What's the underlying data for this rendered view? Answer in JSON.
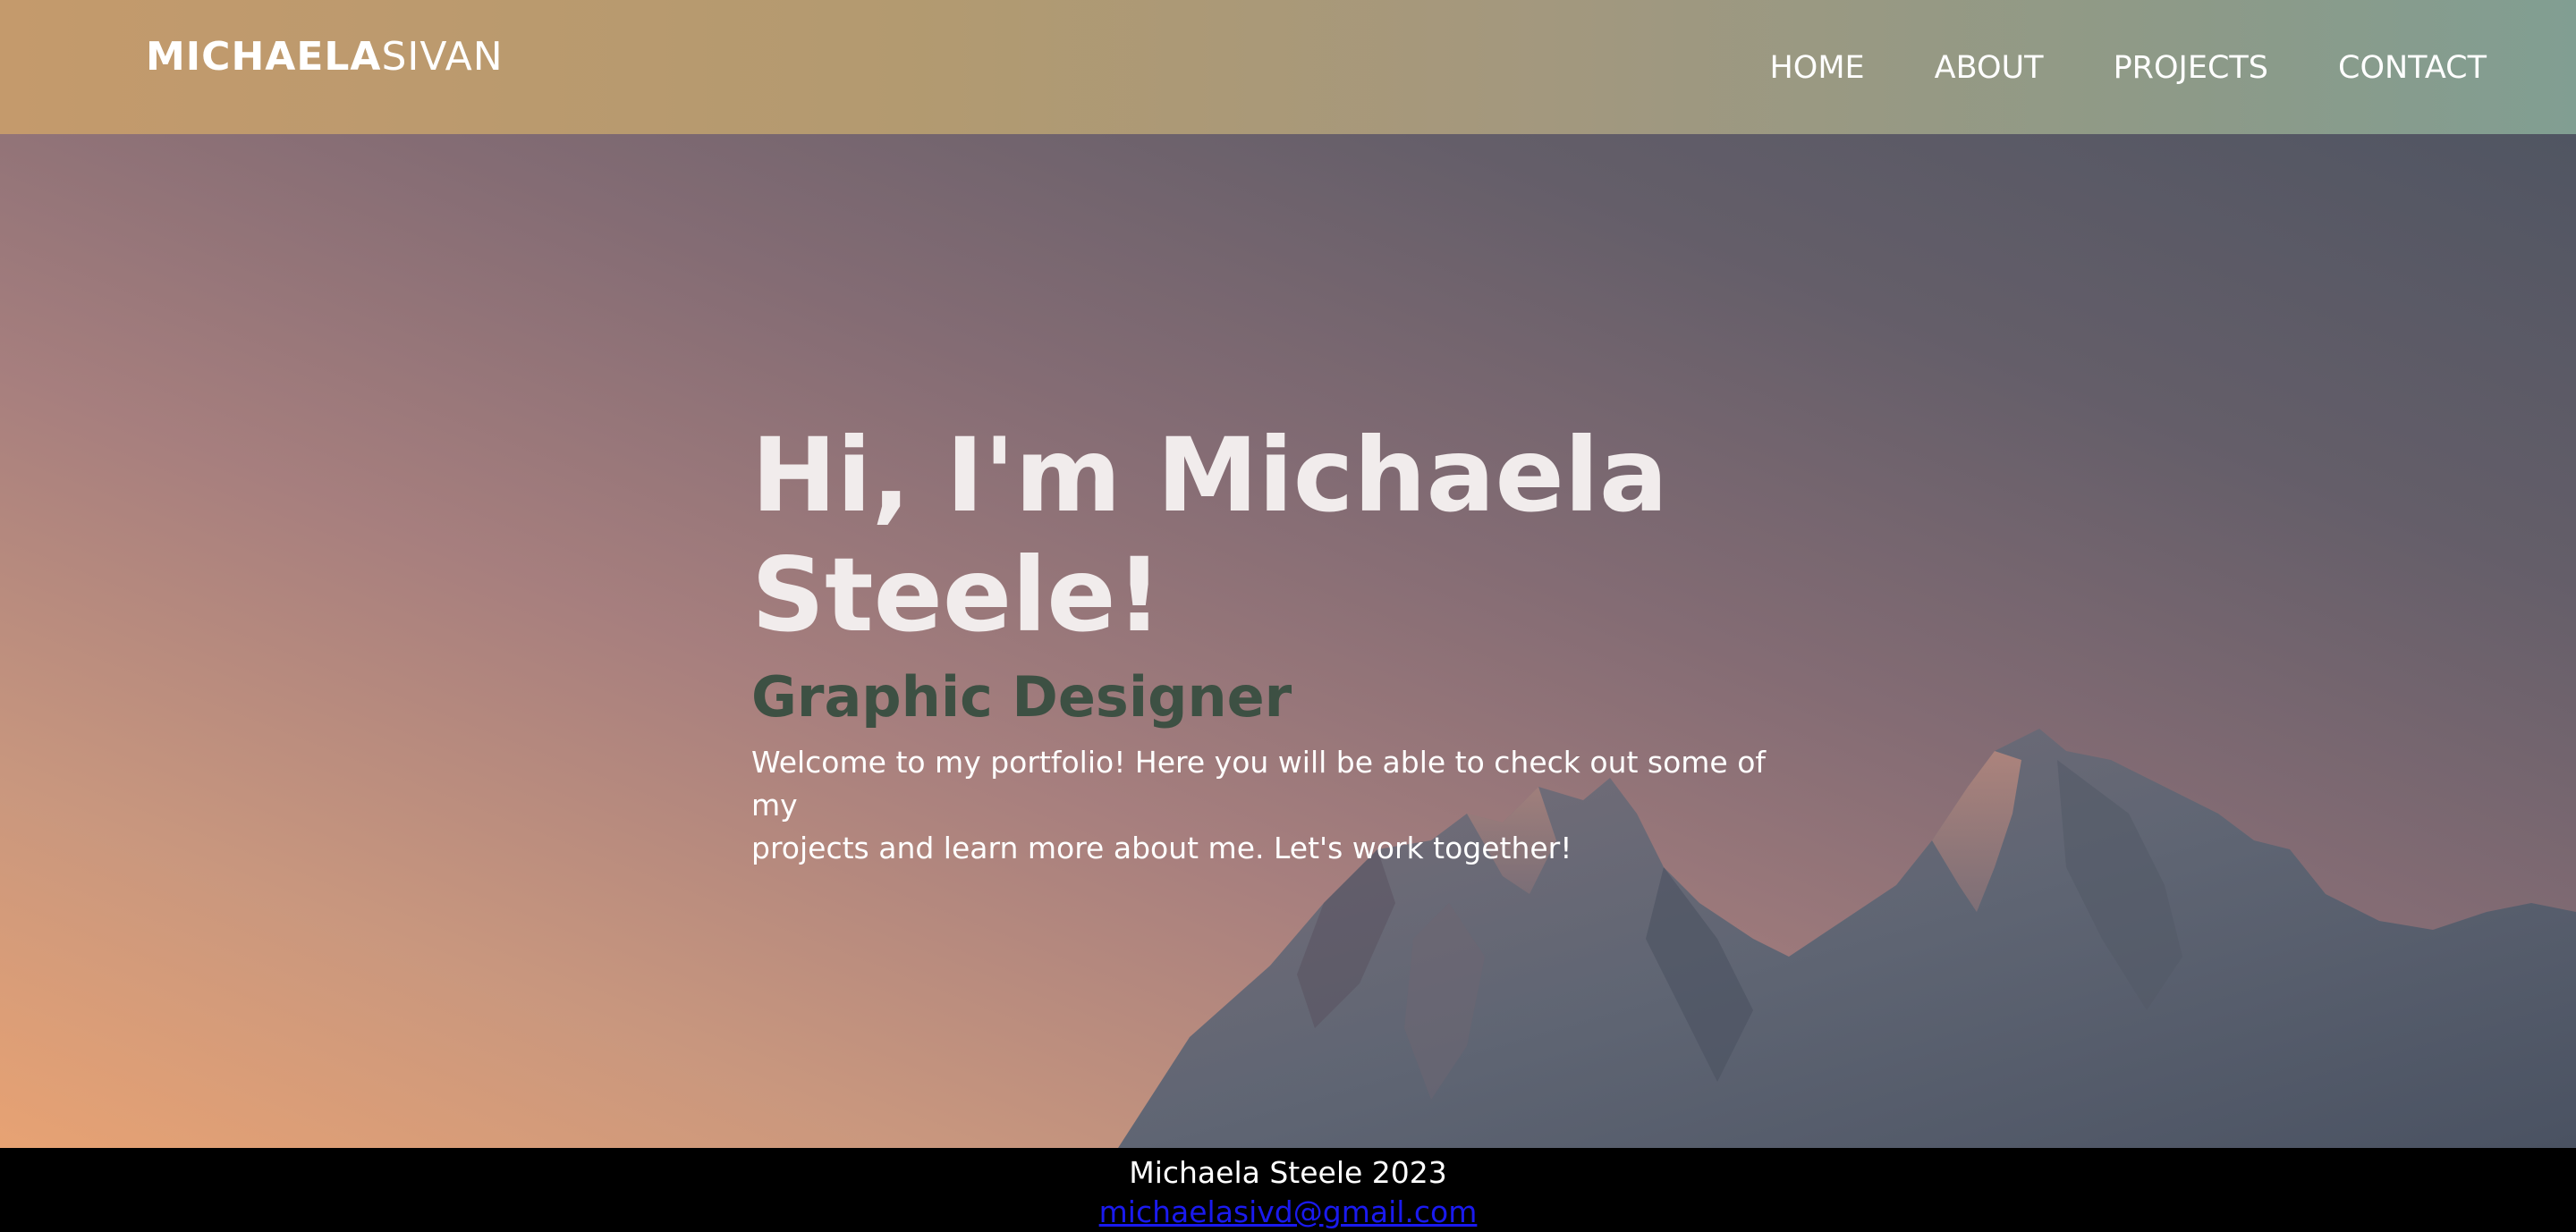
{
  "header": {
    "logo_bold": "MICHAELA",
    "logo_light": "SIVAN",
    "nav": [
      "HOME",
      "ABOUT",
      "PROJECTS",
      "CONTACT"
    ]
  },
  "hero": {
    "title_line1": "Hi, I'm Michaela",
    "title_line2": "Steele!",
    "subtitle": "Graphic Designer",
    "description_line1": "Welcome to my portfolio! Here you will be able to check out some of my",
    "description_line2": "projects and learn more about me. Let's work together!"
  },
  "footer": {
    "name": "Michaela Steele 2023",
    "email": "michaelasivd@gmail.com"
  },
  "colors": {
    "subtitle": "#3d5043",
    "link": "#1a1aee",
    "footer_bg": "#000000"
  }
}
